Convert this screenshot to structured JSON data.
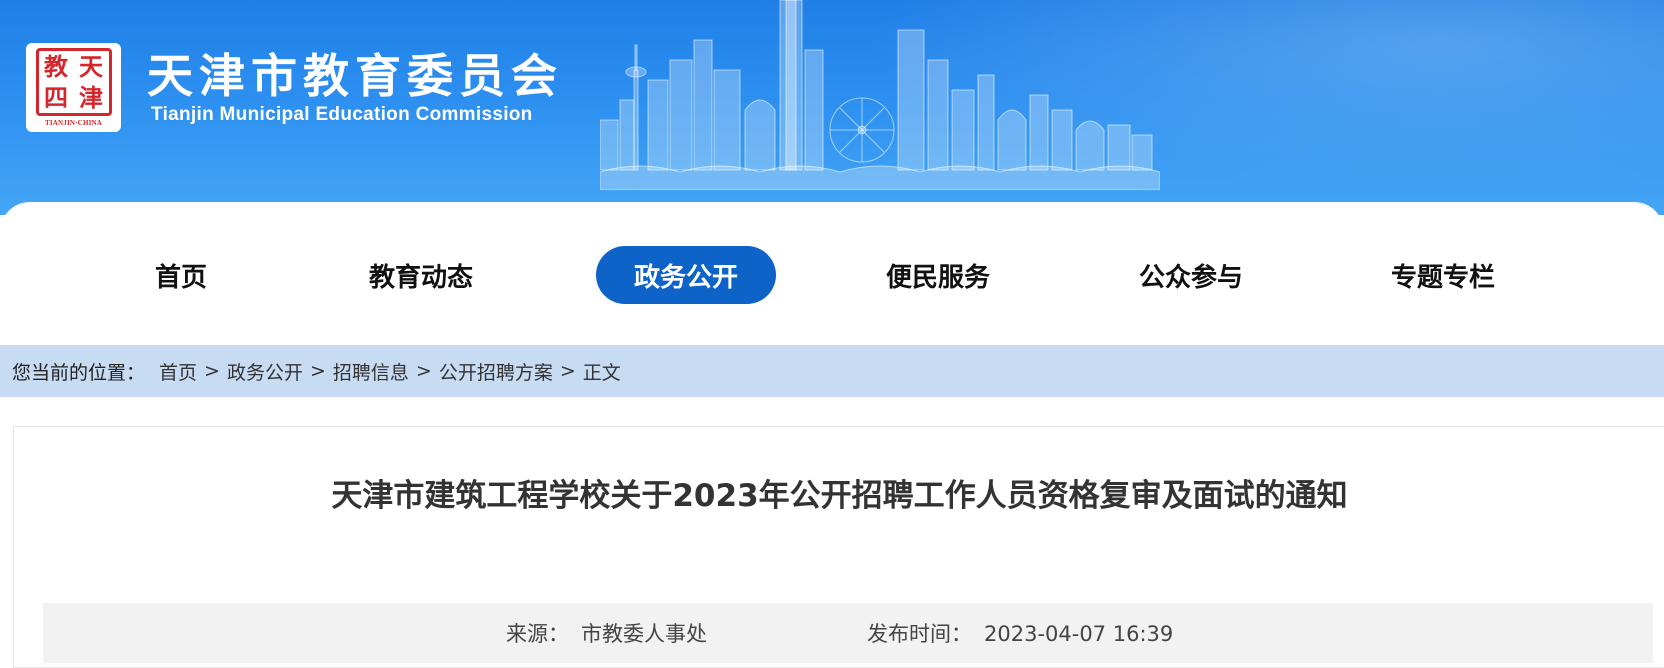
{
  "header": {
    "logo": {
      "seal_text": [
        "天",
        "津",
        "教",
        "四"
      ],
      "caption": "TIANJIN·CHINA"
    },
    "title": "天津市教育委员会",
    "subtitle": "Tianjin Municipal Education Commission"
  },
  "nav": {
    "items": [
      {
        "label": "首页",
        "active": false
      },
      {
        "label": "教育动态",
        "active": false
      },
      {
        "label": "政务公开",
        "active": true
      },
      {
        "label": "便民服务",
        "active": false
      },
      {
        "label": "公众参与",
        "active": false
      },
      {
        "label": "专题专栏",
        "active": false
      }
    ]
  },
  "breadcrumb": {
    "prefix": "您当前的位置：",
    "separator": ">",
    "items": [
      "首页",
      "政务公开",
      "招聘信息",
      "公开招聘方案",
      "正文"
    ]
  },
  "article": {
    "title": "天津市建筑工程学校关于2023年公开招聘工作人员资格复审及面试的通知",
    "source_label": "来源：",
    "source_value": "市教委人事处",
    "date_label": "发布时间：",
    "date_value": "2023-04-07 16:39"
  },
  "colors": {
    "header_blue": "#2c8ff0",
    "nav_active": "#0e63c9",
    "breadcrumb_bg": "#c7dbf3",
    "seal_red": "#d4262c"
  }
}
